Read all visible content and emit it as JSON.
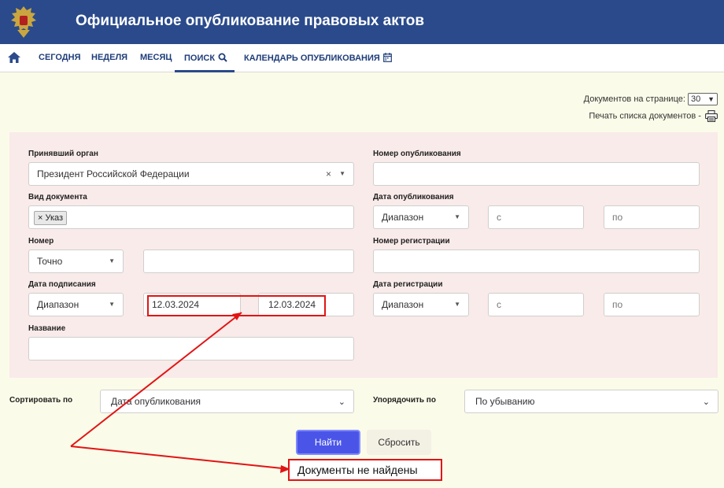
{
  "header": {
    "title": "Официальное опубликование правовых актов",
    "emblem_icon": "coat-of-arms-icon"
  },
  "nav": {
    "home_icon": "home-icon",
    "items": [
      {
        "label": "СЕГОДНЯ"
      },
      {
        "label": "НЕДЕЛЯ"
      },
      {
        "label": "МЕСЯЦ"
      },
      {
        "label": "ПОИСК",
        "icon": "search-icon",
        "active": true
      },
      {
        "label": "КАЛЕНДАРЬ ОПУБЛИКОВАНИЯ",
        "icon": "calendar-icon"
      }
    ]
  },
  "toolbar": {
    "per_page_label": "Документов на странице:",
    "per_page_value": "30",
    "print_label": "Печать списка документов -",
    "print_icon": "printer-icon"
  },
  "form": {
    "authority": {
      "label": "Принявший орган",
      "value": "Президент Российской Федерации",
      "clear": "×"
    },
    "doc_type": {
      "label": "Вид документа",
      "tag": "× Указ"
    },
    "number": {
      "label": "Номер",
      "mode": "Точно",
      "value": ""
    },
    "sign_date": {
      "label": "Дата подписания",
      "mode": "Диапазон",
      "from": "12.03.2024",
      "to": "12.03.2024"
    },
    "name": {
      "label": "Название",
      "value": ""
    },
    "pub_number": {
      "label": "Номер опубликования",
      "value": ""
    },
    "pub_date": {
      "label": "Дата опубликования",
      "mode": "Диапазон",
      "from_placeholder": "с",
      "to_placeholder": "по"
    },
    "reg_number": {
      "label": "Номер регистрации",
      "value": ""
    },
    "reg_date": {
      "label": "Дата регистрации",
      "mode": "Диапазон",
      "from_placeholder": "с",
      "to_placeholder": "по"
    }
  },
  "sort": {
    "sort_by_label": "Сортировать по",
    "sort_by_value": "Дата опубликования",
    "order_label": "Упорядочить по",
    "order_value": "По убыванию"
  },
  "buttons": {
    "find": "Найти",
    "reset": "Сбросить"
  },
  "result": {
    "message": "Документы не найдены"
  },
  "colors": {
    "header_bg": "#2a4a8b",
    "panel_bg": "#f9ebe9",
    "page_bg": "#fbfbe9",
    "find_btn": "#4a55e8",
    "annotation": "#e21414"
  }
}
